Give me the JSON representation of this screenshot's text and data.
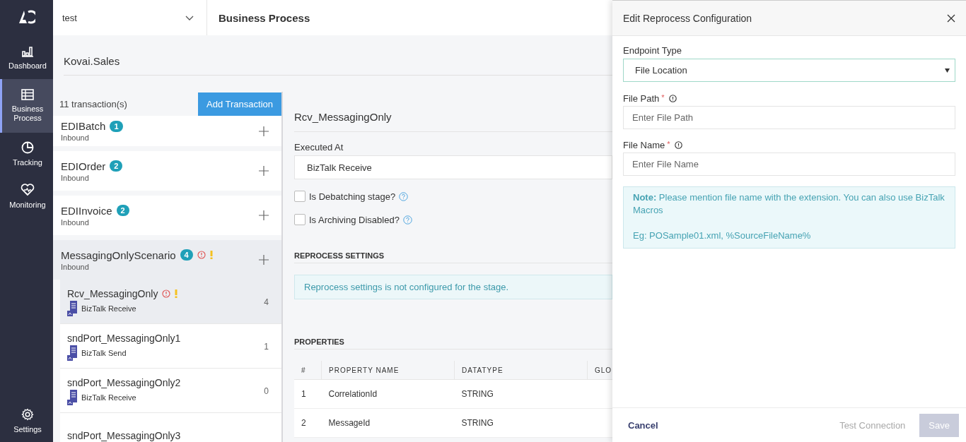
{
  "sidebar": {
    "items": [
      {
        "label": "Dashboard",
        "selected": false
      },
      {
        "label": "Business Process",
        "selected": true
      },
      {
        "label": "Tracking",
        "selected": false
      },
      {
        "label": "Monitoring",
        "selected": false
      }
    ],
    "settings": {
      "label": "Settings"
    }
  },
  "top_bar": {
    "environment": "test",
    "title": "Business Process"
  },
  "application": "Kovai.Sales",
  "transactions": {
    "count": "11 transaction(s)",
    "add_button": "Add Transaction",
    "items": [
      {
        "name": "EDIBatch",
        "badge": "1",
        "direction": "Inbound",
        "error": false,
        "warning": false,
        "selected": false
      },
      {
        "name": "EDIOrder",
        "badge": "2",
        "direction": "Inbound",
        "error": false,
        "warning": false,
        "selected": false
      },
      {
        "name": "EDIInvoice",
        "badge": "2",
        "direction": "Inbound",
        "error": false,
        "warning": false,
        "selected": false
      },
      {
        "name": "MessagingOnlyScenario",
        "badge": "4",
        "direction": "Inbound",
        "error": true,
        "warning": true,
        "selected": true,
        "stages": [
          {
            "name": "Rcv_MessagingOnly",
            "type": "BizTalk Receive",
            "count": "4",
            "error": true,
            "warning": true,
            "selected": true
          },
          {
            "name": "sndPort_MessagingOnly1",
            "type": "BizTalk Send",
            "count": "1",
            "error": false,
            "warning": false,
            "selected": false
          },
          {
            "name": "sndPort_MessagingOnly2",
            "type": "BizTalk Receive",
            "count": "0",
            "error": false,
            "warning": false,
            "selected": false
          },
          {
            "name": "sndPort_MessagingOnly3",
            "error": false,
            "warning": false,
            "selected": false
          }
        ]
      }
    ]
  },
  "stage_detail": {
    "title": "Rcv_MessagingOnly",
    "executed_at_label": "Executed At",
    "executed_at": "BizTalk Receive",
    "options": [
      {
        "label": "Is Debatching stage?",
        "checked": false
      },
      {
        "label": "Is Archiving Disabled?",
        "checked": false
      }
    ],
    "reprocess": {
      "heading": "REPROCESS SETTINGS",
      "message": "Reprocess settings is not configured for the stage."
    },
    "properties": {
      "heading": "PROPERTIES",
      "columns": [
        "#",
        "PROPERTY NAME",
        "DATATYPE",
        "GLO"
      ],
      "rows": [
        [
          "1",
          "CorrelationId",
          "STRING"
        ],
        [
          "2",
          "MessageId",
          "STRING"
        ]
      ]
    }
  },
  "drawer": {
    "title": "Edit Reprocess Configuration",
    "endpoint_label": "Endpoint Type",
    "endpoint_value": "File Location",
    "fields": [
      {
        "label": "File Path",
        "required_mark": "*",
        "placeholder": "Enter File Path"
      },
      {
        "label": "File Name",
        "required_mark": "*",
        "placeholder": "Enter File Name"
      }
    ],
    "note": {
      "text": "**Note:** Please mention file name with the extension. You can also use BizTalk Macros",
      "example": "Eg: POSample01.xml, %SourceFileName%"
    },
    "cancel": "Cancel",
    "test_connection": {
      "label": "Test Connection",
      "disabled": true
    },
    "save": {
      "label": "Save",
      "disabled": true
    }
  }
}
